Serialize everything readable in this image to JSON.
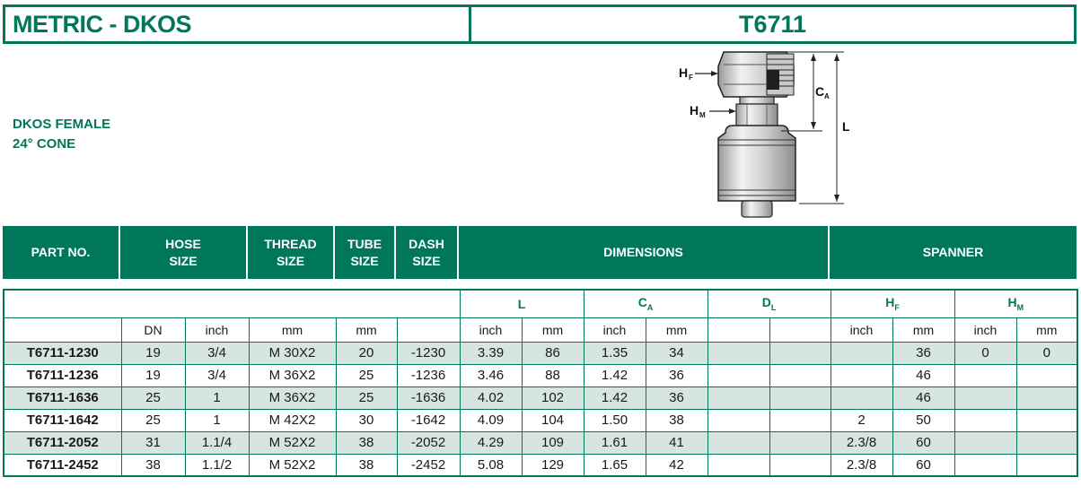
{
  "header": {
    "left_title": "METRIC - DKOS",
    "right_title": "T6711"
  },
  "description": {
    "line1": "DKOS FEMALE",
    "line2": "24° CONE"
  },
  "drawing_labels": {
    "hf": "H",
    "hf_sub": "F",
    "hm": "H",
    "hm_sub": "M",
    "ca": "C",
    "ca_sub": "A",
    "l": "L"
  },
  "columns": {
    "part_no": "PART NO.",
    "hose_1": "HOSE",
    "hose_2": "SIZE",
    "thread_1": "THREAD",
    "thread_2": "SIZE",
    "tube_1": "TUBE",
    "tube_2": "SIZE",
    "dash_1": "DASH",
    "dash_2": "SIZE",
    "dimensions": "DIMENSIONS",
    "spanner": "SPANNER"
  },
  "subheaders": {
    "L": "L",
    "C": "C",
    "C_sub": "A",
    "D": "D",
    "D_sub": "L",
    "H1": "H",
    "H1_sub": "F",
    "H2": "H",
    "H2_sub": "M"
  },
  "units": [
    "DN",
    "inch",
    "mm",
    "mm",
    "inch",
    "mm",
    "inch",
    "mm",
    "inch",
    "mm",
    "inch",
    "mm"
  ],
  "rows": [
    [
      "T6711-1230",
      "19",
      "3/4",
      "M 30X2",
      "20",
      "-1230",
      "3.39",
      "86",
      "1.35",
      "34",
      "",
      "",
      "",
      "36",
      "0",
      "0"
    ],
    [
      "T6711-1236",
      "19",
      "3/4",
      "M 36X2",
      "25",
      "-1236",
      "3.46",
      "88",
      "1.42",
      "36",
      "",
      "",
      "",
      "46",
      "",
      ""
    ],
    [
      "T6711-1636",
      "25",
      "1",
      "M 36X2",
      "25",
      "-1636",
      "4.02",
      "102",
      "1.42",
      "36",
      "",
      "",
      "",
      "46",
      "",
      ""
    ],
    [
      "T6711-1642",
      "25",
      "1",
      "M 42X2",
      "30",
      "-1642",
      "4.09",
      "104",
      "1.50",
      "38",
      "",
      "",
      "2",
      "50",
      "",
      ""
    ],
    [
      "T6711-2052",
      "31",
      "1.1/4",
      "M 52X2",
      "38",
      "-2052",
      "4.29",
      "109",
      "1.61",
      "41",
      "",
      "",
      "2.3/8",
      "60",
      "",
      ""
    ],
    [
      "T6711-2452",
      "38",
      "1.1/2",
      "M 52X2",
      "38",
      "-2452",
      "5.08",
      "129",
      "1.65",
      "42",
      "",
      "",
      "2.3/8",
      "60",
      "",
      ""
    ]
  ],
  "colors": {
    "brand_green": "#00765a",
    "row_shade": "#d6e5df"
  }
}
